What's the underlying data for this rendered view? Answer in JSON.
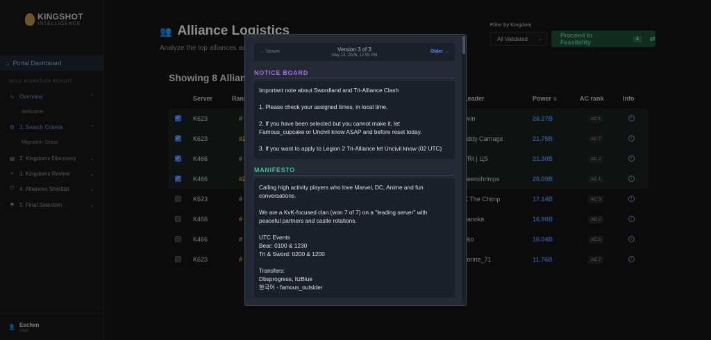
{
  "brand": {
    "title": "KINGSHOT",
    "subtitle": "INTELLIGENCE"
  },
  "sidebar": {
    "portal": "Portal Dashboard",
    "section": "SOLO MIGRATION REPORT",
    "items": [
      {
        "label": "Overview",
        "icon": "activity-icon"
      },
      {
        "label": "Welcome"
      },
      {
        "label": "1. Search Criteria",
        "icon": "settings-icon"
      },
      {
        "label": "Migration Setup"
      },
      {
        "label": "2. Kingdoms Discovery",
        "icon": "map-icon"
      },
      {
        "label": "3. Kingdoms Review",
        "icon": "search-icon"
      },
      {
        "label": "4. Alliances Shortlist",
        "icon": "shield-icon"
      },
      {
        "label": "5. Final Selection",
        "icon": "flag-icon"
      }
    ],
    "user": {
      "name": "Eschen",
      "role": "User"
    }
  },
  "header": {
    "title": "Alliance Logistics",
    "subtitle": "Analyze the top alliances ac",
    "filter_label": "Filter by Kingdom",
    "filter_value": "All Validated",
    "proceed_label": "Proceed to Feasibility",
    "proceed_count": "4",
    "showing": "Showing 8 Alliance"
  },
  "table": {
    "headers": {
      "server": "Server",
      "rank": "Rank",
      "leader": "Leader",
      "power": "Power",
      "ac": "AC rank",
      "info": "Info"
    },
    "rows": [
      {
        "checked": true,
        "server": "K623",
        "rank": "#",
        "leader": "ovin",
        "power": "26.27B",
        "ac": "AC 1"
      },
      {
        "checked": true,
        "server": "K623",
        "rank": "#2",
        "leader": "addy Carnage",
        "power": "21.75B",
        "ac": "AC 7"
      },
      {
        "checked": true,
        "server": "K466",
        "rank": "#",
        "leader": "ŦŔℓ | ЦS",
        "power": "21.30B",
        "ac": "AC 2"
      },
      {
        "checked": true,
        "server": "K466",
        "rank": "#2",
        "leader": "ueenshrimps",
        "power": "20.00B",
        "ac": "AC 1"
      },
      {
        "checked": false,
        "server": "K623",
        "rank": "#",
        "leader": "K The Chimp",
        "power": "17.14B",
        "ac": "AC 3"
      },
      {
        "checked": false,
        "server": "K466",
        "rank": "#",
        "leader": "panoke",
        "power": "16.90B",
        "ac": "AC 2"
      },
      {
        "checked": false,
        "server": "K466",
        "rank": "#",
        "leader": "eko",
        "power": "16.04B",
        "ac": "AC 5"
      },
      {
        "checked": false,
        "server": "K623",
        "rank": "#",
        "leader": "vonne_71",
        "power": "11.76B",
        "ac": "AC 7"
      }
    ]
  },
  "modal": {
    "newer": "← Newer",
    "version": "Version 3 of 3",
    "date": "May 14, 2026, 12:55 PM",
    "older": "Older →",
    "notice_head": "NOTICE BOARD",
    "notice": [
      "Important note about Swordland and Tri-Alliance Clash",
      "1. Please check your assigned times, in local time.",
      "2. If you have been selected but you cannot make it, let\nFamous_cupcake or Uncivil know ASAP and before reset today.",
      "3. If you want to apply to Legion 2 Tri-Alliance let Uncivil know (02 UTC)"
    ],
    "manifesto_head": "MANIFESTO",
    "manifesto": [
      "Calling high activity players who love Marvel, DC, Anime and fun\nconversations.",
      "We are a KvK-focused clan (won 7 of 7) on a \"leading server\" with\npeaceful partners and castle rotations.",
      "UTC Events\nBear: 0100 & 1230\nTri & Sword: 0200 & 1200",
      "Transfers:\nDbsprogress, ItzBlue\n한국어 - famous_outsider"
    ]
  }
}
